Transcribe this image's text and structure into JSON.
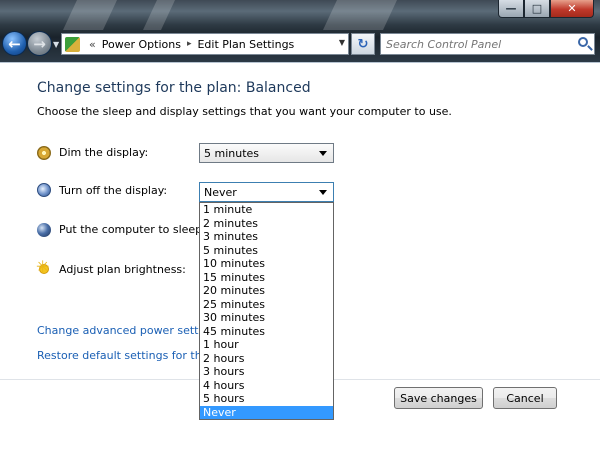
{
  "window": {
    "controls": {
      "minimize": "—",
      "maximize": "□",
      "close": "✕"
    }
  },
  "nav": {
    "breadcrumb": [
      "Power Options",
      "Edit Plan Settings"
    ],
    "breadcrumb_prefix": "«",
    "separator": "▸",
    "search_placeholder": "Search Control Panel",
    "icons": {
      "back": "back-arrow-icon",
      "forward": "forward-arrow-icon",
      "refresh": "refresh-icon",
      "search": "search-icon"
    }
  },
  "page": {
    "heading": "Change settings for the plan: Balanced",
    "description": "Choose the sleep and display settings that you want your computer to use."
  },
  "settings": [
    {
      "label": "Dim the display:",
      "value": "5 minutes",
      "icon": "dim-display-icon"
    },
    {
      "label": "Turn off the display:",
      "value": "Never",
      "icon": "monitor-power-icon"
    },
    {
      "label": "Put the computer to sleep:",
      "icon": "sleep-moon-icon"
    },
    {
      "label": "Adjust plan brightness:",
      "icon": "brightness-sun-icon"
    }
  ],
  "dropdown": {
    "options": [
      "1 minute",
      "2 minutes",
      "3 minutes",
      "5 minutes",
      "10 minutes",
      "15 minutes",
      "20 minutes",
      "25 minutes",
      "30 minutes",
      "45 minutes",
      "1 hour",
      "2 hours",
      "3 hours",
      "4 hours",
      "5 hours",
      "Never"
    ],
    "selected": "Never",
    "highlight_color": "#3399ff"
  },
  "links": {
    "advanced": "Change advanced power settings",
    "restore": "Restore default settings for this pla"
  },
  "buttons": {
    "save": "Save changes",
    "cancel": "Cancel"
  },
  "colors": {
    "heading": "#1e395b",
    "link": "#1a5fb4"
  }
}
